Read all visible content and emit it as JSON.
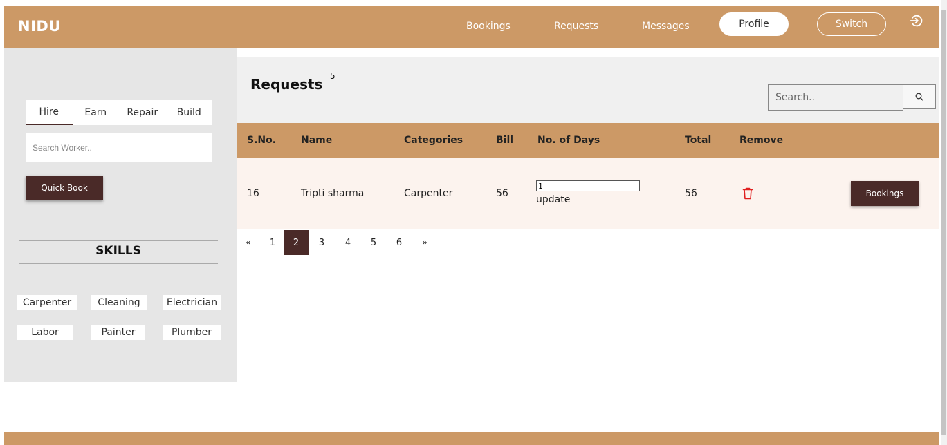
{
  "navbar": {
    "brand": "NIDU",
    "links": [
      "Bookings",
      "Requests",
      "Messages"
    ],
    "profile_label": "Profile",
    "switch_label": "Switch",
    "logout_icon": "logout-icon"
  },
  "sidebar": {
    "tabs": [
      "Hire",
      "Earn",
      "Repair",
      "Build"
    ],
    "active_tab": "Hire",
    "search_placeholder": "Search Worker..",
    "quick_book_label": "Quick Book",
    "skills_title": "SKILLS",
    "skills": [
      "Carpenter",
      "Cleaning",
      "Electrician",
      "Labor",
      "Painter",
      "Plumber"
    ]
  },
  "main": {
    "title": "Requests",
    "count": "5",
    "search_placeholder": "Search..",
    "search_icon": "search-icon",
    "columns": [
      "S.No.",
      "Name",
      "Categories",
      "Bill",
      "No. of Days",
      "Total",
      "Remove"
    ],
    "rows": [
      {
        "sno": "16",
        "name": "Tripti sharma",
        "category": "Carpenter",
        "bill": "56",
        "days_value": "1",
        "update_label": "update",
        "total": "56",
        "remove_icon": "trash-icon",
        "action_label": "Bookings"
      }
    ],
    "pagination": {
      "prev": "«",
      "pages": [
        "1",
        "2",
        "3",
        "4",
        "5",
        "6"
      ],
      "current": "2",
      "next": "»"
    }
  },
  "colors": {
    "accent": "#cc9966",
    "dark_button": "#4a2a28",
    "trash": "#e02020"
  }
}
